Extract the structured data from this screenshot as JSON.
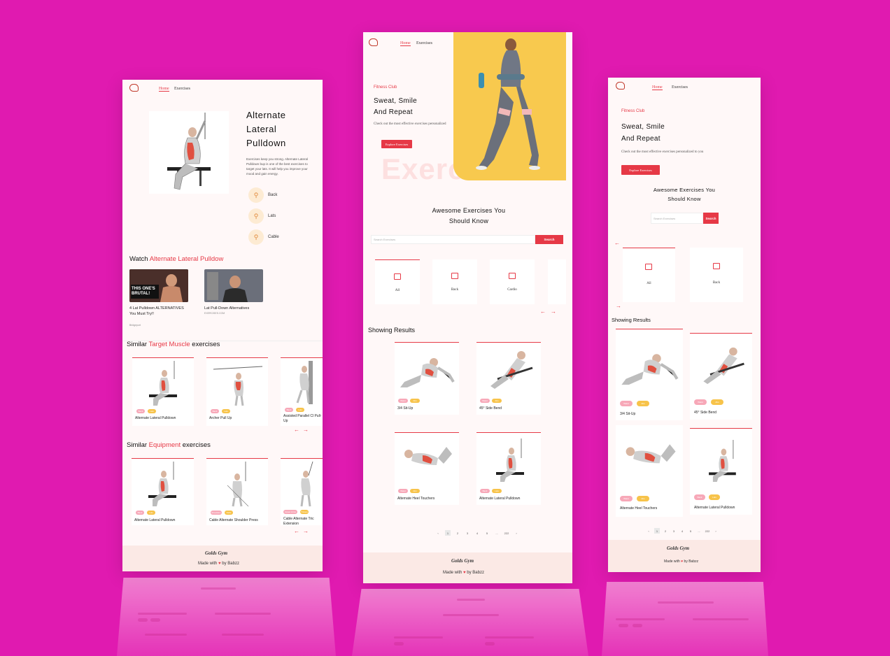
{
  "brand": {
    "footer_name": "Golds Gym",
    "made_with_prefix": "Made with",
    "made_with_suffix": "by Babzz"
  },
  "nav": {
    "home": "Home",
    "exercises": "Exercises"
  },
  "colors": {
    "background": "#e01ab0",
    "accent": "#e63946",
    "page": "#fff8f8",
    "pill_pink": "#f7a8b8",
    "pill_yellow": "#f7c34a"
  },
  "detail": {
    "title_line1": "Alternate",
    "title_line2": "Lateral",
    "title_line3": "Pulldown",
    "description": "Exercises keep you strong. Alternate Lateral Pulldown bup is one of the best exercises to target your lats. It will help you improve your mood and gain energy.",
    "tags": [
      {
        "icon": "body-part-icon",
        "label": "Back"
      },
      {
        "icon": "target-icon",
        "label": "Lats"
      },
      {
        "icon": "equipment-icon",
        "label": "Cable"
      }
    ],
    "watch_prefix": "Watch",
    "watch_highlight": "Alternate Lateral Pulldow",
    "videos": [
      {
        "title": "4 Lat Pulldown ALTERNATIVES You Must Try!!",
        "channel": "Bridgeport",
        "overlay": "THIS ONE'S BRUTAL!"
      },
      {
        "title": "Lat Pull-Down Alternatives",
        "channel": "EXERCISES.COM"
      }
    ],
    "similar_target": {
      "prefix": "Similar",
      "highlight": "Target Muscle",
      "suffix": "exercises",
      "cards": [
        {
          "name": "Alternate Lateral Pulldown",
          "tags": [
            "Back",
            "Lats"
          ]
        },
        {
          "name": "Archer Pull Up",
          "tags": [
            "Back",
            "Lats"
          ]
        },
        {
          "name": "Assisted Parallel Cl Pull-Up",
          "tags": [
            "Back",
            "Lats"
          ]
        }
      ]
    },
    "similar_equipment": {
      "prefix": "Similar",
      "highlight": "Equipment",
      "suffix": "exercises",
      "cards": [
        {
          "name": "Alternate Lateral Pulldown",
          "tags": [
            "Back",
            "Lats"
          ]
        },
        {
          "name": "Cable Alternate Shoulder Press",
          "tags": [
            "Shoulders",
            "Delts"
          ]
        },
        {
          "name": "Cable Alternate Tric Extension",
          "tags": [
            "Upper Arms",
            "Triceps"
          ]
        }
      ]
    }
  },
  "home": {
    "fitness_club": "Fitness Club",
    "hero_line1": "Sweat, Smile",
    "hero_line2": "And Repeat",
    "hero_sub": "Check out the most effective exercises personalized to you",
    "hero_sub_short": "Check out the most effective exercises personalized",
    "explore_button": "Explore Exercises",
    "bg_word": "Exercise",
    "awesome_line1": "Awesome Exercises You",
    "awesome_line2": "Should Know",
    "search_placeholder": "Search Exercises",
    "search_button": "Search",
    "body_parts": [
      "All",
      "Back",
      "Cardio"
    ],
    "showing_results": "Showing Results",
    "results": [
      {
        "name": "3/4 Sit-Up",
        "tags": [
          "Waist",
          "Abs"
        ]
      },
      {
        "name": "45° Side Bend",
        "tags": [
          "Waist",
          "Abs"
        ]
      },
      {
        "name": "Alternate Heel Touchers",
        "tags": [
          "Waist",
          "Abs"
        ]
      },
      {
        "name": "Alternate Lateral Pulldown",
        "tags": [
          "Back",
          "Lats"
        ]
      }
    ],
    "pagination": [
      "‹",
      "1",
      "2",
      "3",
      "4",
      "5",
      "...",
      "222",
      "›"
    ]
  }
}
